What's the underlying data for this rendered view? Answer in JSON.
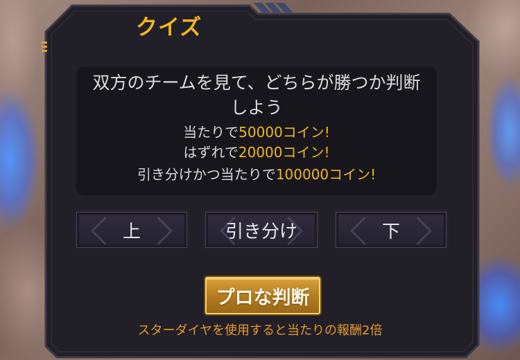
{
  "quiz": {
    "title": "クイズ",
    "description": "双方のチームを見て、どちらが勝つか判断しよう",
    "rewards": [
      {
        "prefix": "当たりで",
        "amount": "50000コイン!"
      },
      {
        "prefix": "はずれで",
        "amount": "20000コイン!"
      },
      {
        "prefix": "引き分けかつ当たりで",
        "amount": "100000コイン!"
      }
    ],
    "choices": {
      "up": "上",
      "draw": "引き分け",
      "down": "下"
    },
    "pro_button": "プロな判断",
    "note": "スターダイヤを使用すると当たりの報酬2倍"
  },
  "colors": {
    "accent_gold": "#f2b51d",
    "panel_bg": "#211f27",
    "text_light": "#dcdcdc",
    "note_orange": "#e89a2c"
  }
}
